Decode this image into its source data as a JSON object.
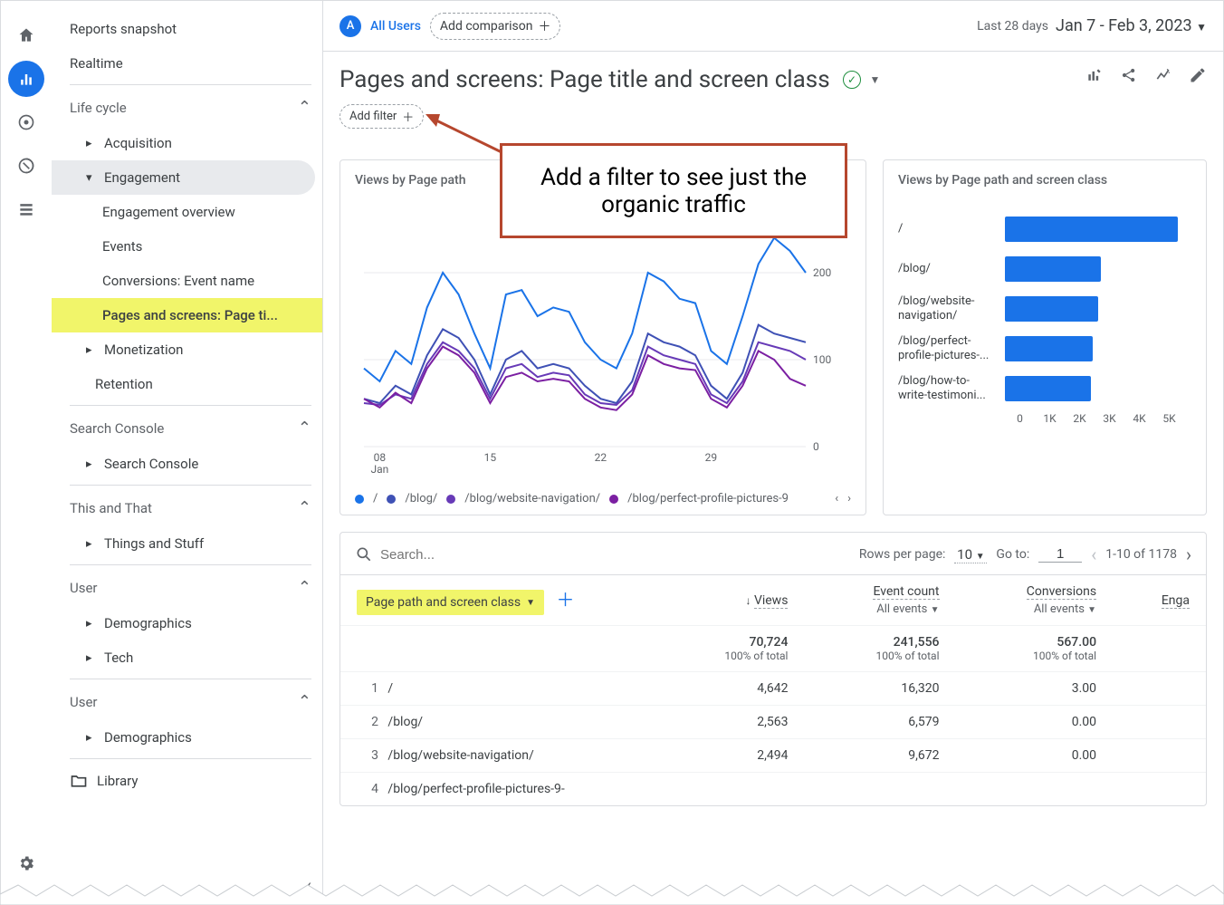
{
  "topbar": {
    "all_users": "All Users",
    "add_comparison": "Add comparison",
    "last_label": "Last 28 days",
    "date_range": "Jan 7 - Feb 3, 2023"
  },
  "title": {
    "prefix": "Pages and screens: ",
    "metric": "Page title and screen class"
  },
  "add_filter": "Add filter",
  "sidebar": {
    "top": [
      "Reports snapshot",
      "Realtime"
    ],
    "lifecycle": {
      "label": "Life cycle",
      "items": {
        "acquisition": "Acquisition",
        "engagement": "Engagement",
        "engagement_children": [
          "Engagement overview",
          "Events",
          "Conversions: Event name",
          "Pages and screens: Page ti..."
        ],
        "monetization": "Monetization",
        "retention": "Retention"
      }
    },
    "search_console": {
      "label": "Search Console",
      "items": [
        "Search Console"
      ]
    },
    "this_that": {
      "label": "This and That",
      "items": [
        "Things and Stuff"
      ]
    },
    "user1": {
      "label": "User",
      "items": [
        "Demographics",
        "Tech"
      ]
    },
    "user2": {
      "label": "User",
      "items": [
        "Demographics"
      ]
    },
    "library": "Library"
  },
  "annotation": "Add a filter to see just the organic traffic",
  "chart_data": {
    "line": {
      "title": "Views by Page path",
      "ylim": [
        0,
        250
      ],
      "yticks": [
        0,
        100,
        200
      ],
      "xticks": [
        "08\nJan",
        "15",
        "22",
        "29"
      ],
      "x_count": 29,
      "series": [
        {
          "name": "/",
          "color": "#1a73e8",
          "values": [
            90,
            75,
            110,
            95,
            160,
            200,
            175,
            130,
            90,
            175,
            180,
            150,
            160,
            155,
            120,
            100,
            90,
            130,
            200,
            190,
            170,
            165,
            110,
            95,
            150,
            210,
            240,
            225,
            200
          ]
        },
        {
          "name": "/blog/",
          "color": "#3f51b5",
          "values": [
            55,
            50,
            70,
            60,
            105,
            135,
            125,
            100,
            60,
            100,
            110,
            90,
            95,
            90,
            70,
            55,
            50,
            75,
            130,
            120,
            115,
            105,
            70,
            55,
            85,
            140,
            130,
            125,
            120
          ]
        },
        {
          "name": "/blog/website-navigation/",
          "color": "#673ab7",
          "values": [
            50,
            48,
            60,
            55,
            95,
            120,
            110,
            90,
            55,
            90,
            95,
            80,
            85,
            82,
            60,
            50,
            48,
            65,
            115,
            105,
            100,
            95,
            60,
            50,
            75,
            120,
            115,
            110,
            100
          ]
        },
        {
          "name": "/blog/perfect-profile-pictures-9",
          "color": "#7b1fa2",
          "values": [
            55,
            45,
            62,
            50,
            90,
            115,
            105,
            85,
            50,
            80,
            85,
            75,
            78,
            75,
            55,
            45,
            42,
            60,
            105,
            95,
            90,
            88,
            55,
            45,
            70,
            110,
            100,
            78,
            70
          ]
        }
      ]
    },
    "bar": {
      "title": "Views by Page path and screen class",
      "xlabel_ticks": [
        "0",
        "1K",
        "2K",
        "3K",
        "4K",
        "5K"
      ],
      "xmax": 5000,
      "items": [
        {
          "label": "/",
          "value": 4642
        },
        {
          "label": "/blog/",
          "value": 2563
        },
        {
          "label": "/blog/website-navigation/",
          "value": 2494
        },
        {
          "label": "/blog/perfect-profile-pictures-...",
          "value": 2350
        },
        {
          "label": "/blog/how-to-write-testimoni...",
          "value": 2300
        }
      ]
    }
  },
  "table": {
    "search_placeholder": "Search...",
    "rows_label": "Rows per page:",
    "rows_per_page": "10",
    "goto_label": "Go to:",
    "goto_value": "1",
    "range": "1-10 of 1178",
    "dimension": "Page path and screen class",
    "headers": {
      "views": "Views",
      "event_count": "Event count",
      "conversions": "Conversions",
      "engagement": "Enga",
      "all_events": "All events"
    },
    "totals": {
      "views": "70,724",
      "event_count": "241,556",
      "conversions": "567.00",
      "pct": "100% of total"
    },
    "rows": [
      {
        "i": "1",
        "path": "/",
        "views": "4,642",
        "events": "16,320",
        "conv": "3.00"
      },
      {
        "i": "2",
        "path": "/blog/",
        "views": "2,563",
        "events": "6,579",
        "conv": "0.00"
      },
      {
        "i": "3",
        "path": "/blog/website-navigation/",
        "views": "2,494",
        "events": "9,672",
        "conv": "0.00"
      },
      {
        "i": "4",
        "path": "/blog/perfect-profile-pictures-9-",
        "views": "",
        "events": "",
        "conv": ""
      }
    ]
  }
}
